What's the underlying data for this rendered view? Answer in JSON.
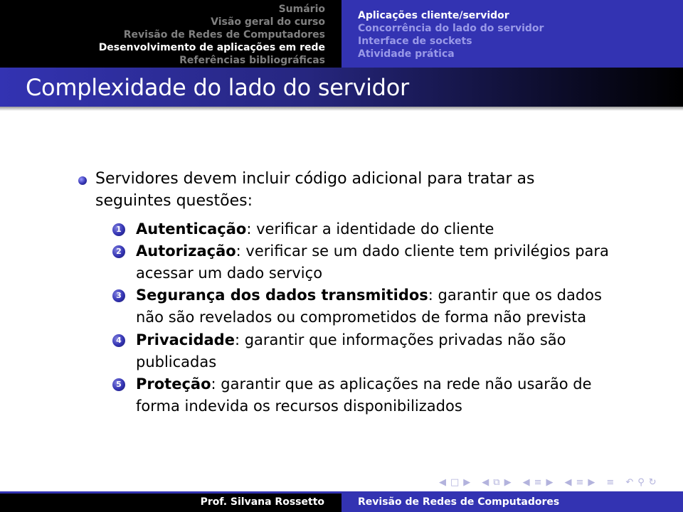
{
  "header": {
    "sections": [
      {
        "label": "Sumário",
        "active": false
      },
      {
        "label": "Visão geral do curso",
        "active": false
      },
      {
        "label": "Revisão de Redes de Computadores",
        "active": false
      },
      {
        "label": "Desenvolvimento de aplicações em rede",
        "active": true
      },
      {
        "label": "Referências bibliográficas",
        "active": false
      }
    ],
    "subsections": [
      {
        "label": "Aplicações cliente/servidor",
        "active": true
      },
      {
        "label": "Concorrência do lado do servidor",
        "active": false
      },
      {
        "label": "Interface de sockets",
        "active": false
      },
      {
        "label": "Atividade prática",
        "active": false
      }
    ]
  },
  "frame": {
    "title": "Complexidade do lado do servidor"
  },
  "content": {
    "bullet": {
      "line1": "Servidores devem incluir código adicional para tratar as",
      "line2": "seguintes questões:"
    },
    "items": [
      {
        "num": "1",
        "term": "Autenticação",
        "lines": [
          ": verificar a identidade do cliente"
        ]
      },
      {
        "num": "2",
        "term": "Autorização",
        "lines": [
          ": verificar se um dado cliente tem privilégios para",
          "acessar um dado serviço"
        ]
      },
      {
        "num": "3",
        "term": "Segurança dos dados transmitidos",
        "lines": [
          ": garantir que os dados",
          "não são revelados ou comprometidos de forma não prevista"
        ]
      },
      {
        "num": "4",
        "term": "Privacidade",
        "lines": [
          ": garantir que informações privadas não são",
          "publicadas"
        ]
      },
      {
        "num": "5",
        "term": "Proteção",
        "lines": [
          ": garantir que as aplicações na rede não usarão de",
          "forma indevida os recursos disponibilizados"
        ]
      }
    ]
  },
  "navigation": {
    "icons": [
      "frame-prev-icon",
      "frame-icon",
      "frame-next-icon",
      "subsection-prev-icon",
      "subsection-icon",
      "subsection-next-icon",
      "section-prev-icon",
      "section-icon",
      "section-next-icon",
      "presentation-prev-icon",
      "presentation-icon",
      "presentation-next-icon",
      "align-icon",
      "back-icon",
      "search-icon",
      "forward-icon"
    ]
  },
  "footer": {
    "author": "Prof. Silvana Rossetto",
    "title": "Revisão de Redes de Computadores"
  },
  "colors": {
    "accent": "#3333b2",
    "header_dark": "#000000",
    "text": "#000000"
  }
}
